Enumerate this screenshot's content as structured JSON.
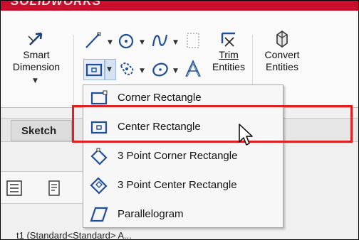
{
  "app": {
    "logo_text": "SOLIDWORKS"
  },
  "ribbon": {
    "smart_dimension": {
      "label_line1": "Smart",
      "label_line2": "Dimension",
      "icon": "smart-dimension-icon"
    },
    "trim_entities": {
      "label_line1": "Trim",
      "label_line2": "Entities",
      "icon": "trim-entities-icon"
    },
    "convert_entities": {
      "label_line1": "Convert",
      "label_line2": "Entities",
      "icon": "convert-entities-icon"
    },
    "tools": [
      {
        "name": "line",
        "icon": "line-icon"
      },
      {
        "name": "circle",
        "icon": "circle-icon"
      },
      {
        "name": "spline",
        "icon": "spline-icon"
      },
      {
        "name": "plane",
        "icon": "plane-icon"
      },
      {
        "name": "rectangle",
        "icon": "rectangle-icon"
      },
      {
        "name": "slot",
        "icon": "slot-icon"
      },
      {
        "name": "polygon",
        "icon": "polygon-icon"
      },
      {
        "name": "text",
        "icon": "text-icon"
      }
    ]
  },
  "tabs": {
    "sketch": "Sketch"
  },
  "menu": {
    "items": [
      {
        "label": "Corner Rectangle",
        "icon": "corner-rectangle-icon"
      },
      {
        "label": "Center Rectangle",
        "icon": "center-rectangle-icon"
      },
      {
        "label": "3 Point Corner Rectangle",
        "icon": "3-point-corner-rectangle-icon"
      },
      {
        "label": "3 Point Center Rectangle",
        "icon": "3-point-center-rectangle-icon"
      },
      {
        "label": "Parallelogram",
        "icon": "parallelogram-icon"
      }
    ]
  },
  "feature_tree": {
    "partial_text": "t1 (Standard<Standard> A..."
  },
  "colors": {
    "highlight": "#e02020",
    "brand": "#c8102e",
    "icon_blue": "#1f4e9a"
  }
}
